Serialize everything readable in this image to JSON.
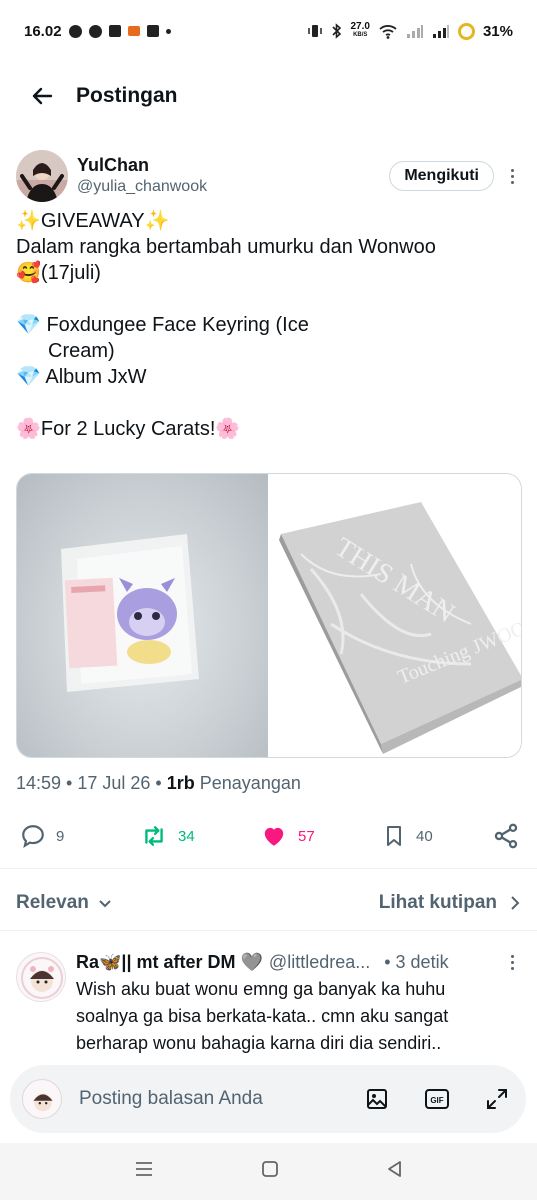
{
  "status": {
    "time": "16.02",
    "net_speed": "27.0",
    "net_unit": "KB/S",
    "battery": "31%"
  },
  "header": {
    "title": "Postingan"
  },
  "post": {
    "author_name": "YulChan",
    "author_handle": "@yulia_chanwook",
    "follow_label": "Mengikuti",
    "text_lines": [
      "✨GIVEAWAY✨",
      "Dalam rangka bertambah umurku dan Wonwoo",
      "🥰(17juli)",
      "💎 Foxdungee Face Keyring (Ice",
      "Cream)",
      "💎 Album JxW",
      "🌸For 2 Lucky Carats!🌸"
    ],
    "time": "14:59",
    "date": "17 Jul 26",
    "views_count": "1rb",
    "views_label": "Penayangan",
    "replies": "9",
    "reposts": "34",
    "likes": "57",
    "bookmarks": "40"
  },
  "sort": {
    "label": "Relevan",
    "quotes_label": "Lihat kutipan"
  },
  "reply": {
    "name": "Ra🦋|| mt after DM 🩶",
    "handle": "@littledrea...",
    "time": "• 3 detik",
    "lines": [
      "Wish aku buat wonu emng ga banyak ka huhu",
      "soalnya ga bisa berkata-kata.. cmn aku sangat",
      "berharap wonu bahagia karna diri dia sendiri.."
    ]
  },
  "composer": {
    "placeholder": "Posting balasan Anda",
    "gif_label": "GIF"
  },
  "album_cover_text": [
    "THIS MAN",
    "Touching JWOO"
  ],
  "colors": {
    "like": "#f91880",
    "repost": "#00ba7c",
    "muted": "#536471"
  }
}
